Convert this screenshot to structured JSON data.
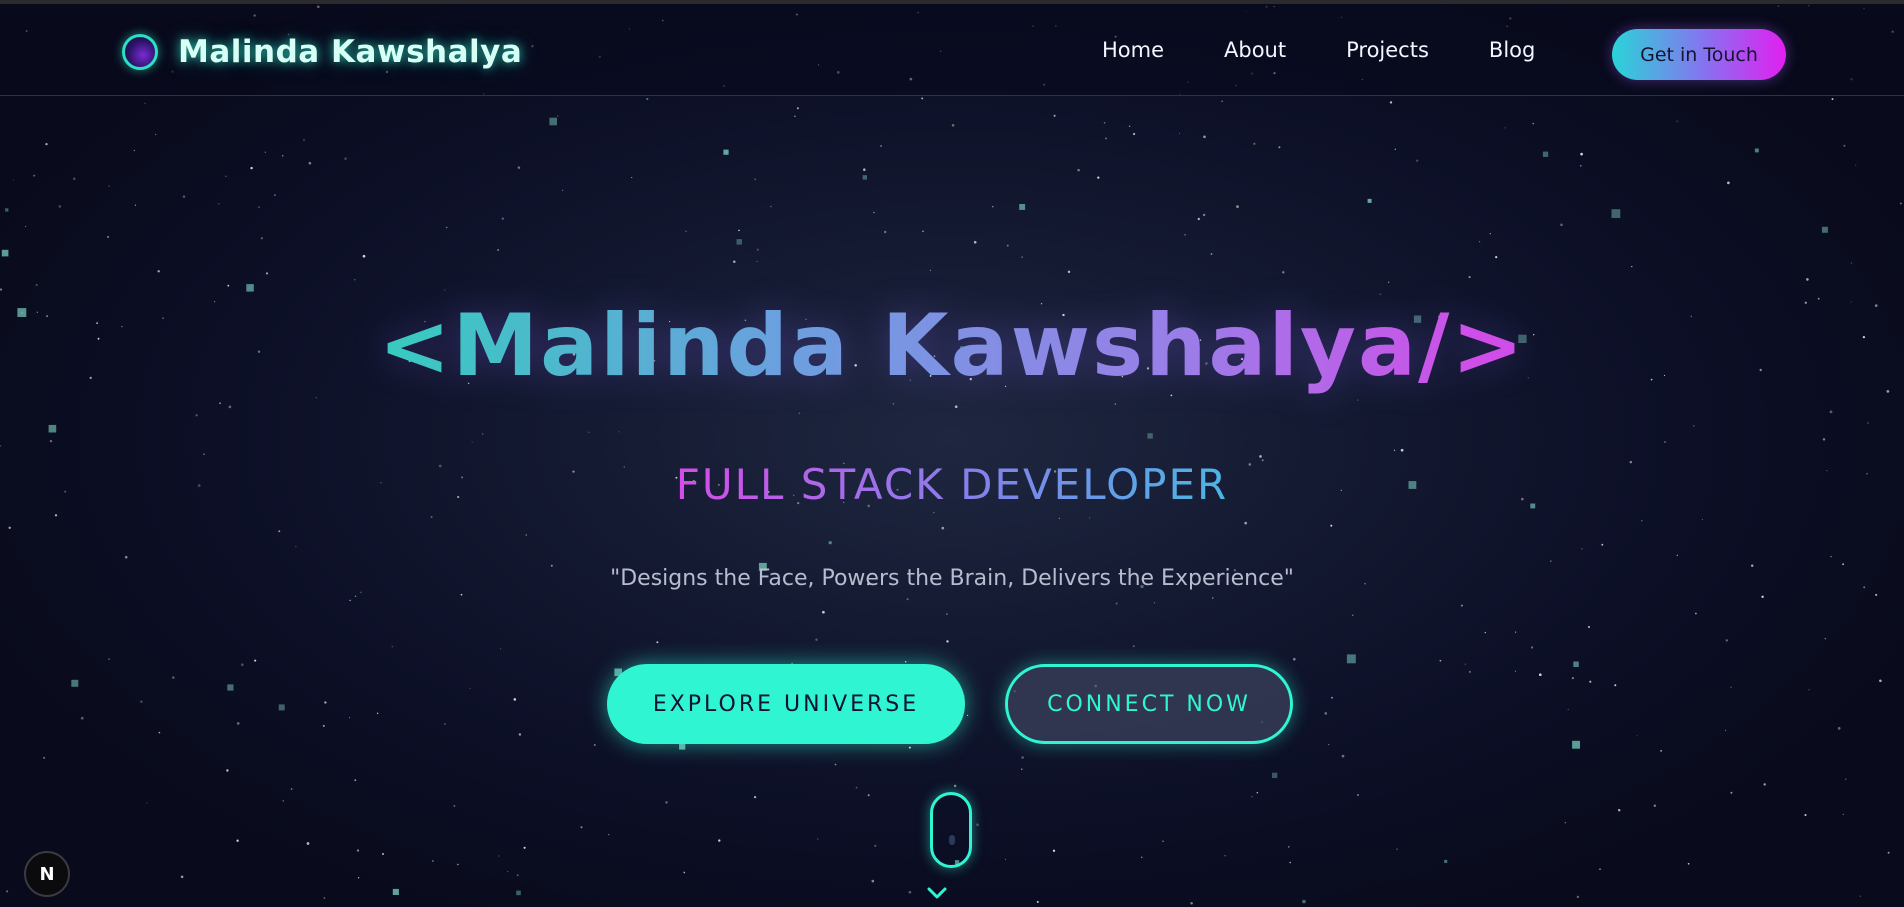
{
  "nav": {
    "brand_name": "Malinda Kawshalya",
    "logo_icon": "planet-logo-icon",
    "links": [
      {
        "label": "Home"
      },
      {
        "label": "About"
      },
      {
        "label": "Projects"
      },
      {
        "label": "Blog"
      }
    ],
    "cta_label": "Get in Touch"
  },
  "hero": {
    "title": "<Malinda Kawshalya/>",
    "subtitle": "FULL STACK DEVELOPER",
    "quote": "\"Designs the Face, Powers the Brain, Delivers the Experience\"",
    "primary_button": "EXPLORE UNIVERSE",
    "secondary_button": "CONNECT NOW"
  },
  "scroll": {
    "icon": "mouse-scroll-icon",
    "chevron_icon": "chevron-down-icon"
  },
  "dev_badge": {
    "label": "N",
    "icon": "nextjs-devtools-icon"
  },
  "colors": {
    "accent_teal": "#2ff5d2",
    "accent_magenta": "#e21ff0",
    "accent_purple": "#8a6ff0",
    "background": "#0a0c1f"
  }
}
